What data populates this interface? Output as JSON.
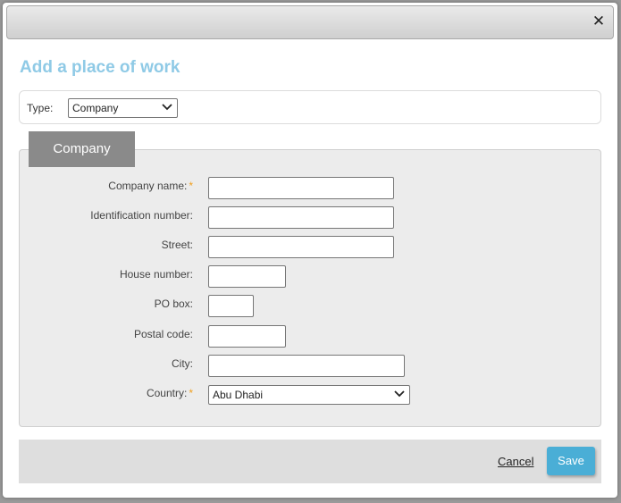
{
  "dialog": {
    "close_icon": "close-icon",
    "heading": "Add a place of work"
  },
  "type_row": {
    "label": "Type:",
    "selected": "Company"
  },
  "panel": {
    "tab_label": "Company",
    "fields": {
      "company_name": {
        "label": "Company name:",
        "required_mark": "*",
        "value": ""
      },
      "identification_number": {
        "label": "Identification number:",
        "value": ""
      },
      "street": {
        "label": "Street:",
        "value": ""
      },
      "house_number": {
        "label": "House number:",
        "value": ""
      },
      "po_box": {
        "label": "PO box:",
        "value": ""
      },
      "postal_code": {
        "label": "Postal code:",
        "value": ""
      },
      "city": {
        "label": "City:",
        "value": ""
      },
      "country": {
        "label": "Country:",
        "required_mark": "*",
        "selected": "Abu Dhabi"
      }
    }
  },
  "footer": {
    "cancel_label": "Cancel",
    "save_label": "Save"
  },
  "colors": {
    "heading": "#8fcae6",
    "required": "#f0a020",
    "save_button": "#4aaed6",
    "tab": "#8a8a8a"
  }
}
